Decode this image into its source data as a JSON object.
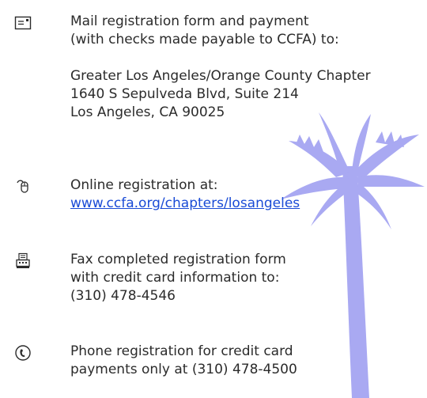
{
  "entries": [
    {
      "icon": "envelope-icon",
      "lines": [
        "Mail registration form and payment",
        "(with checks made payable to CCFA) to:"
      ],
      "address": [
        "Greater Los Angeles/Orange County Chapter",
        "1640 S Sepulveda Blvd, Suite 214",
        "Los Angeles, CA 90025"
      ]
    },
    {
      "icon": "computer-mouse-icon",
      "lines": [
        "Online registration at:"
      ],
      "link": "www.ccfa.org/chapters/losangeles"
    },
    {
      "icon": "fax-machine-icon",
      "lines": [
        "Fax completed registration form",
        "with credit card information to:",
        "(310) 478-4546"
      ]
    },
    {
      "icon": "telephone-icon",
      "lines": [
        "Phone registration for credit card",
        "payments only at (310) 478-4500"
      ]
    }
  ],
  "colors": {
    "text": "#2b2b2b",
    "link": "#1a4bd6",
    "palm": "#a9a9f2"
  }
}
